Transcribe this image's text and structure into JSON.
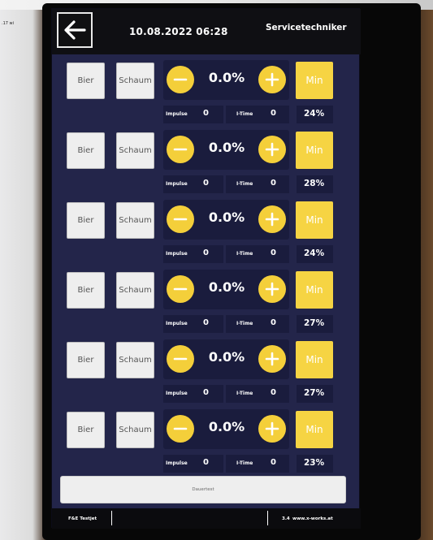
{
  "photo_note": ".17  wi",
  "header": {
    "back_icon": "arrow-left-icon",
    "datetime": "10.08.2022 06:28",
    "user": "Servicetechniker"
  },
  "rows": [
    {
      "bier": "Bier",
      "schaum": "Schaum",
      "percent_setting": "0.0%",
      "min": "Min",
      "impulse_label": "Impulse",
      "impulse_value": "0",
      "itime_label": "I-Time",
      "itime_value": "0",
      "percent": "24%"
    },
    {
      "bier": "Bier",
      "schaum": "Schaum",
      "percent_setting": "0.0%",
      "min": "Min",
      "impulse_label": "Impulse",
      "impulse_value": "0",
      "itime_label": "I-Time",
      "itime_value": "0",
      "percent": "28%"
    },
    {
      "bier": "Bier",
      "schaum": "Schaum",
      "percent_setting": "0.0%",
      "min": "Min",
      "impulse_label": "Impulse",
      "impulse_value": "0",
      "itime_label": "I-Time",
      "itime_value": "0",
      "percent": "24%"
    },
    {
      "bier": "Bier",
      "schaum": "Schaum",
      "percent_setting": "0.0%",
      "min": "Min",
      "impulse_label": "Impulse",
      "impulse_value": "0",
      "itime_label": "I-Time",
      "itime_value": "0",
      "percent": "27%"
    },
    {
      "bier": "Bier",
      "schaum": "Schaum",
      "percent_setting": "0.0%",
      "min": "Min",
      "impulse_label": "Impulse",
      "impulse_value": "0",
      "itime_label": "I-Time",
      "itime_value": "0",
      "percent": "27%"
    },
    {
      "bier": "Bier",
      "schaum": "Schaum",
      "percent_setting": "0.0%",
      "min": "Min",
      "impulse_label": "Impulse",
      "impulse_value": "0",
      "itime_label": "I-Time",
      "itime_value": "0",
      "percent": "23%"
    }
  ],
  "dauertest_label": "Dauertest",
  "footer": {
    "brand": "F&E Testjet",
    "version": "3.4",
    "website": "www.x-works.at"
  },
  "colors": {
    "screen_bg": "#23254a",
    "panel_bg": "#1a1c3d",
    "accent_yellow": "#f4cf3a",
    "header_bg": "#0f0f13"
  }
}
